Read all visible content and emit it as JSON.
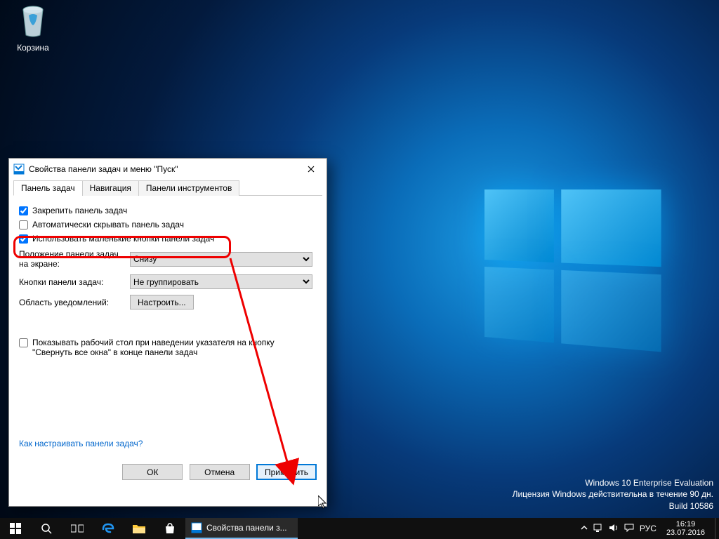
{
  "desktop": {
    "recycle_bin_label": "Корзина"
  },
  "watermark": {
    "line1": "Windows 10 Enterprise Evaluation",
    "line2": "Лицензия Windows действительна в течение 90 дн.",
    "line3": "Build 10586"
  },
  "dialog": {
    "title": "Свойства панели задач и меню \"Пуск\"",
    "tabs": {
      "taskbar": "Панель задач",
      "navigation": "Навигация",
      "toolbars": "Панели инструментов"
    },
    "checkboxes": {
      "lock": {
        "label": "Закрепить панель задач",
        "checked": true
      },
      "autohide": {
        "label": "Автоматически скрывать панель задач",
        "checked": false
      },
      "small_buttons": {
        "label": "Использовать маленькие кнопки панели задач",
        "checked": true
      },
      "peek": {
        "label": "Показывать рабочий стол при наведении указателя на кнопку \"Свернуть все окна\" в конце панели задач",
        "checked": false
      }
    },
    "position": {
      "label": "Положение панели задач на экране:",
      "value": "Снизу"
    },
    "buttons_combine": {
      "label": "Кнопки панели задач:",
      "value": "Не группировать"
    },
    "notification_area": {
      "label": "Область уведомлений:",
      "button": "Настроить..."
    },
    "help_link": "Как настраивать панели задач?",
    "footer": {
      "ok": "ОК",
      "cancel": "Отмена",
      "apply": "Применить"
    }
  },
  "taskbar": {
    "task_label": "Свойства панели з...",
    "lang": "РУС",
    "time": "16:19",
    "date": "23.07.2016"
  }
}
